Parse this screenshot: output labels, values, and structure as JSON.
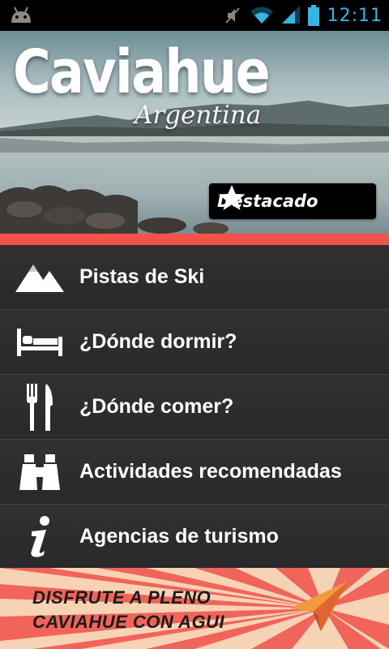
{
  "status_bar": {
    "time": "12:11",
    "icons": [
      "android-debug-icon",
      "mute-icon",
      "wifi-icon",
      "signal-icon",
      "battery-icon"
    ]
  },
  "header": {
    "title": "Caviahue",
    "subtitle": "Argentina",
    "featured_label": "Destacado"
  },
  "menu": {
    "items": [
      {
        "label": "Pistas de Ski",
        "icon": "mountain-icon"
      },
      {
        "label": "¿Dónde dormir?",
        "icon": "bed-icon"
      },
      {
        "label": "¿Dónde comer?",
        "icon": "fork-knife-icon"
      },
      {
        "label": "Actividades recomendadas",
        "icon": "binoculars-icon"
      },
      {
        "label": "Agencias de turismo",
        "icon": "info-icon"
      }
    ]
  },
  "banner": {
    "line1": "DISFRUTE A PLENO",
    "line2": "CAVIAHUE CON AGUI"
  },
  "colors": {
    "accent_red": "#f25349",
    "clock_blue": "#33b5e5",
    "menu_bg": "#2c2c2c"
  }
}
